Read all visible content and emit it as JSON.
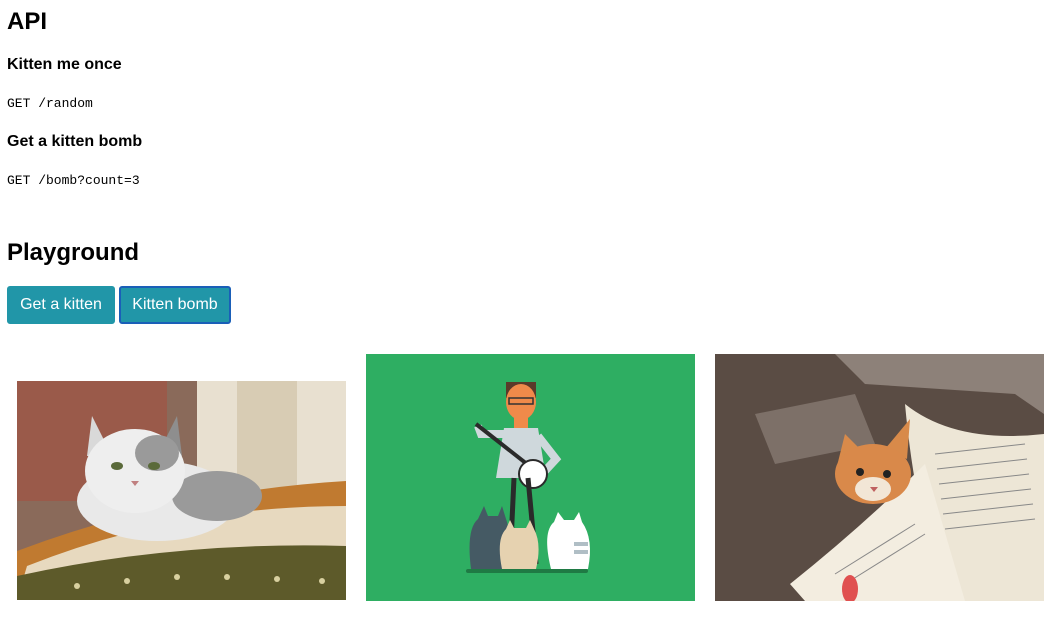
{
  "api": {
    "title": "API",
    "endpoints": [
      {
        "heading": "Kitten me once",
        "code": "GET /random"
      },
      {
        "heading": "Get a kitten bomb",
        "code": "GET /bomb?count=3"
      }
    ]
  },
  "playground": {
    "title": "Playground",
    "buttons": [
      {
        "label": "Get a kitten"
      },
      {
        "label": "Kitten bomb"
      }
    ]
  },
  "images": [
    {
      "name": "cat-in-basket-photo"
    },
    {
      "name": "banjo-man-with-cats-illustration"
    },
    {
      "name": "cat-peeking-over-book-photo"
    }
  ],
  "colors": {
    "button_bg": "#2196a8",
    "button_focus_border": "#1a5fb8",
    "illustration_bg": "#2eae62"
  }
}
